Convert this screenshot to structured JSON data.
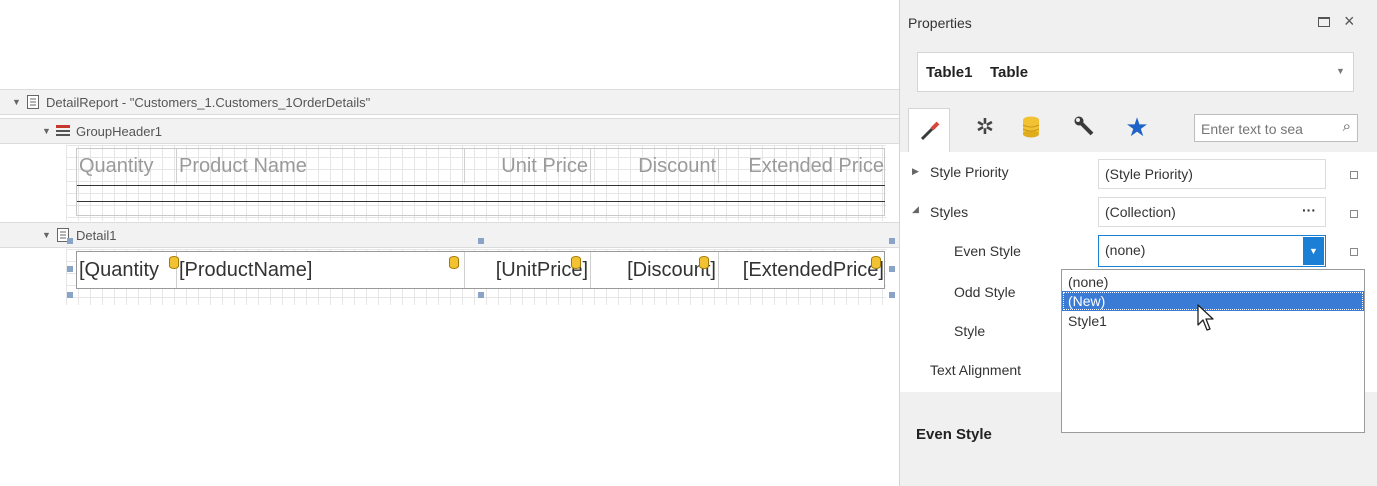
{
  "designer": {
    "detail_report_label": "DetailReport - \"Customers_1.Customers_1OrderDetails\"",
    "group_header_label": "GroupHeader1",
    "detail_label": "Detail1",
    "header_cells": [
      "Quantity",
      "Product Name",
      "Unit Price",
      "Discount",
      "Extended Price"
    ],
    "detail_cells": [
      "[Quantity",
      "[ProductName]",
      "[UnitPrice]",
      "[Discount]",
      "[ExtendedPrice]"
    ]
  },
  "properties": {
    "title": "Properties",
    "object_name": "Table1",
    "object_type": "Table",
    "search_placeholder": "Enter text to sea",
    "rows": {
      "style_priority_label": "Style Priority",
      "style_priority_value": "(Style Priority)",
      "styles_label": "Styles",
      "styles_value": "(Collection)",
      "ellipsis": "···",
      "even_style_label": "Even Style",
      "even_style_value": "(none)",
      "odd_style_label": "Odd Style",
      "style_label": "Style",
      "text_alignment_label": "Text Alignment"
    },
    "dropdown_options": [
      "(none)",
      "(New)",
      "Style1"
    ],
    "selected_option_index": 1,
    "description_title": "Even Style"
  },
  "colors": {
    "accent": "#1c7fd6",
    "selection": "#3a7bd5",
    "band_header_bg": "#f2f2f2",
    "panel_bg": "#f0f0f0"
  }
}
